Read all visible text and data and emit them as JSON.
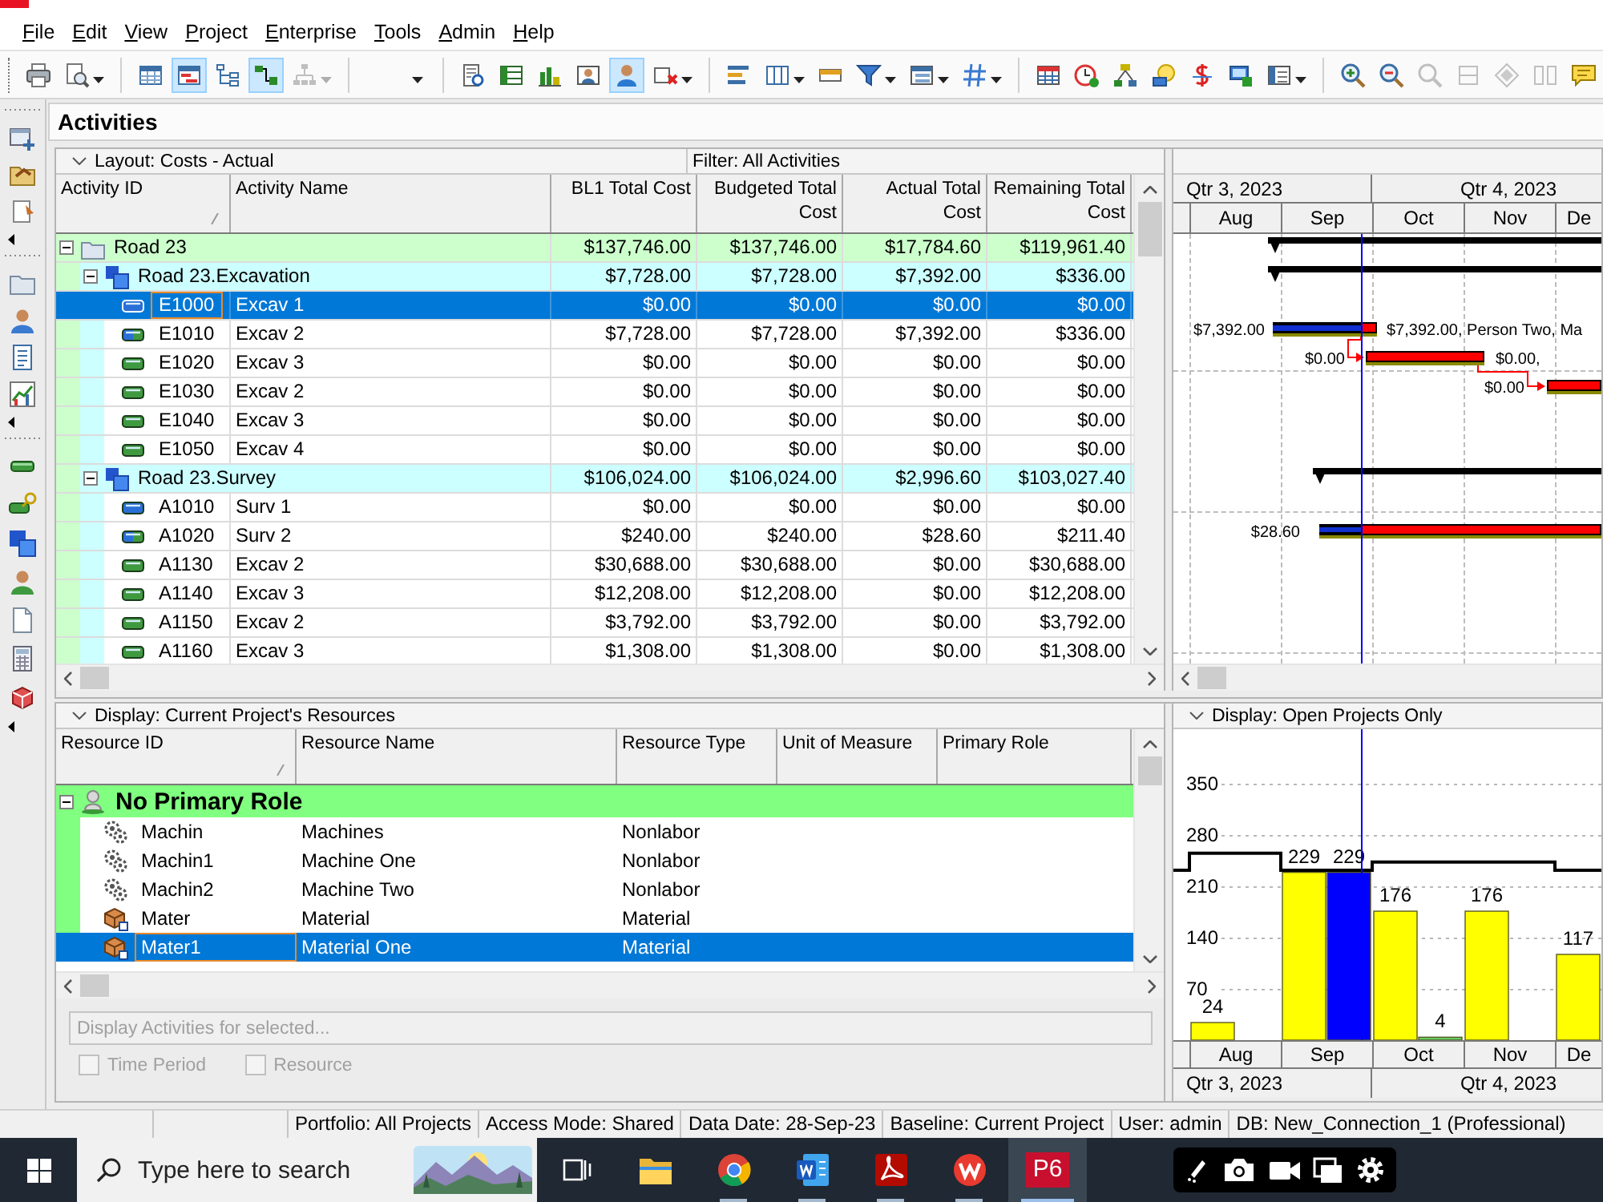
{
  "menu": [
    {
      "label": "File"
    },
    {
      "label": "Edit"
    },
    {
      "label": "View"
    },
    {
      "label": "Project"
    },
    {
      "label": "Enterprise"
    },
    {
      "label": "Tools"
    },
    {
      "label": "Admin"
    },
    {
      "label": "Help"
    }
  ],
  "toolbar": {
    "groups": [
      {
        "items": [
          {
            "kind": "printer",
            "pressed": false,
            "disabled": false
          },
          {
            "kind": "print_preview",
            "pressed": false,
            "disabled": false
          }
        ]
      },
      {
        "items": [
          {
            "kind": "table",
            "pressed": false,
            "disabled": false
          },
          {
            "kind": "gantt",
            "pressed": true,
            "disabled": false
          },
          {
            "kind": "tree",
            "pressed": false,
            "disabled": false
          },
          {
            "kind": "network",
            "pressed": true,
            "disabled": false
          },
          {
            "kind": "hierarchy",
            "pressed": false,
            "disabled": true
          }
        ]
      },
      {
        "items": [
          {
            "kind": "blank",
            "pressed": false,
            "disabled": false
          }
        ]
      },
      {
        "items": [
          {
            "kind": "report",
            "pressed": false,
            "disabled": false
          },
          {
            "kind": "spreadsheet",
            "pressed": false,
            "disabled": false
          },
          {
            "kind": "bar_chart",
            "pressed": false,
            "disabled": false
          },
          {
            "kind": "resource_table",
            "pressed": false,
            "disabled": false
          },
          {
            "kind": "person",
            "pressed": true,
            "disabled": false
          },
          {
            "kind": "cross",
            "pressed": false,
            "disabled": false
          }
        ]
      },
      {
        "items": [
          {
            "kind": "bars",
            "pressed": false,
            "disabled": false
          },
          {
            "kind": "columns",
            "pressed": false,
            "disabled": false
          },
          {
            "kind": "strip",
            "pressed": false,
            "disabled": false
          },
          {
            "kind": "filter",
            "pressed": false,
            "disabled": false
          },
          {
            "kind": "group",
            "pressed": false,
            "disabled": false
          },
          {
            "kind": "hash",
            "pressed": false,
            "disabled": false
          }
        ]
      },
      {
        "items": [
          {
            "kind": "grid",
            "pressed": false,
            "disabled": false
          },
          {
            "kind": "clock",
            "pressed": false,
            "disabled": false
          },
          {
            "kind": "network_diagram",
            "pressed": false,
            "disabled": false
          },
          {
            "kind": "bulb",
            "pressed": false,
            "disabled": false
          },
          {
            "kind": "dollar",
            "pressed": false,
            "disabled": false
          },
          {
            "kind": "monitor",
            "pressed": false,
            "disabled": false
          },
          {
            "kind": "list",
            "pressed": false,
            "disabled": false
          }
        ]
      },
      {
        "items": [
          {
            "kind": "zoom_in",
            "pressed": false,
            "disabled": false
          },
          {
            "kind": "zoom_out",
            "pressed": false,
            "disabled": false
          },
          {
            "kind": "zoom_fit",
            "pressed": false,
            "disabled": true
          },
          {
            "kind": "rows",
            "pressed": false,
            "disabled": true
          },
          {
            "kind": "diamond",
            "pressed": false,
            "disabled": true
          },
          {
            "kind": "split",
            "pressed": false,
            "disabled": true
          },
          {
            "kind": "comment",
            "pressed": false,
            "disabled": false
          }
        ]
      }
    ]
  },
  "page_title": "Activities",
  "activities": {
    "layout": "Layout: Costs - Actual",
    "filter": "Filter: All Activities",
    "columns": [
      {
        "label": "Activity ID",
        "sorted": true
      },
      {
        "label": "Activity Name",
        "sorted": false
      },
      {
        "label": "BL1 Total Cost",
        "sorted": false
      },
      {
        "label": "Budgeted Total Cost",
        "sorted": false
      },
      {
        "label": "Actual Total Cost",
        "sorted": false
      },
      {
        "label": "Remaining Total Cost",
        "sorted": false
      }
    ],
    "rows": [
      {
        "kind": "project",
        "label": "Road 23",
        "expanded": true,
        "selected": false,
        "costs": [
          "$137,746.00",
          "$137,746.00",
          "$17,784.60",
          "$119,961.40"
        ],
        "children": [
          {
            "kind": "wbs",
            "label": "Road 23.Excavation",
            "expanded": true,
            "selected": false,
            "costs": [
              "$7,728.00",
              "$7,728.00",
              "$7,392.00",
              "$336.00"
            ],
            "children": [
              {
                "kind": "completed",
                "id": "E1000",
                "name": "Excav 1",
                "selected": true,
                "costs": [
                  "$0.00",
                  "$0.00",
                  "$0.00",
                  "$0.00"
                ]
              },
              {
                "kind": "in_progress",
                "id": "E1010",
                "name": "Excav 2",
                "selected": false,
                "costs": [
                  "$7,728.00",
                  "$7,728.00",
                  "$7,392.00",
                  "$336.00"
                ],
                "bar_label_left": "$7,392.00",
                "bar_label_right": "$7,392.00, Person Two, Ma"
              },
              {
                "kind": "not_started",
                "id": "E1020",
                "name": "Excav 3",
                "selected": false,
                "costs": [
                  "$0.00",
                  "$0.00",
                  "$0.00",
                  "$0.00"
                ],
                "bar_label_left": "$0.00",
                "bar_label_right": "$0.00,"
              },
              {
                "kind": "not_started",
                "id": "E1030",
                "name": "Excav 2",
                "selected": false,
                "costs": [
                  "$0.00",
                  "$0.00",
                  "$0.00",
                  "$0.00"
                ],
                "bar_label_left": "$0.00"
              },
              {
                "kind": "not_started",
                "id": "E1040",
                "name": "Excav 3",
                "selected": false,
                "costs": [
                  "$0.00",
                  "$0.00",
                  "$0.00",
                  "$0.00"
                ]
              },
              {
                "kind": "not_started",
                "id": "E1050",
                "name": "Excav 4",
                "selected": false,
                "costs": [
                  "$0.00",
                  "$0.00",
                  "$0.00",
                  "$0.00"
                ]
              }
            ]
          },
          {
            "kind": "wbs",
            "label": "Road 23.Survey",
            "expanded": true,
            "selected": false,
            "costs": [
              "$106,024.00",
              "$106,024.00",
              "$2,996.60",
              "$103,027.40"
            ],
            "children": [
              {
                "kind": "completed",
                "id": "A1010",
                "name": "Surv 1",
                "selected": false,
                "costs": [
                  "$0.00",
                  "$0.00",
                  "$0.00",
                  "$0.00"
                ]
              },
              {
                "kind": "in_progress",
                "id": "A1020",
                "name": "Surv 2",
                "selected": false,
                "costs": [
                  "$240.00",
                  "$240.00",
                  "$28.60",
                  "$211.40"
                ],
                "bar_label_left": "$28.60"
              },
              {
                "kind": "not_started",
                "id": "A1130",
                "name": "Excav 2",
                "selected": false,
                "costs": [
                  "$30,688.00",
                  "$30,688.00",
                  "$0.00",
                  "$30,688.00"
                ]
              },
              {
                "kind": "not_started",
                "id": "A1140",
                "name": "Excav 3",
                "selected": false,
                "costs": [
                  "$12,208.00",
                  "$12,208.00",
                  "$0.00",
                  "$12,208.00"
                ]
              },
              {
                "kind": "not_started",
                "id": "A1150",
                "name": "Excav 2",
                "selected": false,
                "costs": [
                  "$3,792.00",
                  "$3,792.00",
                  "$0.00",
                  "$3,792.00"
                ]
              },
              {
                "kind": "not_started",
                "id": "A1160",
                "name": "Excav 3",
                "selected": false,
                "costs": [
                  "$1,308.00",
                  "$1,308.00",
                  "$0.00",
                  "$1,308.00"
                ]
              }
            ]
          }
        ]
      }
    ]
  },
  "gantt": {
    "quarters": [
      "Qtr 3, 2023",
      "Qtr 4, 2023"
    ],
    "months": [
      "Aug",
      "Sep",
      "Oct",
      "Nov",
      "De"
    ]
  },
  "resources": {
    "display": "Display: Current Project's Resources",
    "columns": [
      {
        "label": "Resource ID",
        "sorted": true
      },
      {
        "label": "Resource Name",
        "sorted": false
      },
      {
        "label": "Resource Type",
        "sorted": false
      },
      {
        "label": "Unit of Measure",
        "sorted": false
      },
      {
        "label": "Primary Role",
        "sorted": false
      }
    ],
    "groups": [
      {
        "kind": "role",
        "label": "No Primary Role",
        "expanded": true,
        "selected": false,
        "children": [
          {
            "kind": "nonlabor",
            "id": "Machin",
            "name": "Machines",
            "type": "Nonlabor",
            "selected": false
          },
          {
            "kind": "nonlabor",
            "id": "Machin1",
            "name": "Machine One",
            "type": "Nonlabor",
            "selected": false
          },
          {
            "kind": "nonlabor",
            "id": "Machin2",
            "name": "Machine Two",
            "type": "Nonlabor",
            "selected": false
          },
          {
            "kind": "material",
            "id": "Mater",
            "name": "Material",
            "type": "Material",
            "selected": false
          },
          {
            "kind": "material",
            "id": "Mater1",
            "name": "Material One",
            "type": "Material",
            "selected": true
          }
        ]
      }
    ],
    "display_activities": {
      "label": "Display Activities for selected...",
      "disabled": true
    },
    "options": [
      {
        "label": "Time Period",
        "checked": false,
        "disabled": true
      },
      {
        "label": "Resource",
        "checked": false,
        "disabled": true
      }
    ]
  },
  "histogram": {
    "display": "Display: Open Projects Only",
    "chart_data": {
      "type": "bar",
      "categories": [
        "Aug",
        "Sep",
        "Oct",
        "Nov",
        "De"
      ],
      "series": [
        {
          "color": "#ffff00",
          "values": [
            24,
            229,
            176,
            176,
            117
          ]
        },
        {
          "color": "#0000ff",
          "values": [
            null,
            229,
            null,
            null,
            null
          ]
        },
        {
          "color": "#66cc66",
          "values": [
            null,
            null,
            4,
            null,
            null
          ]
        }
      ],
      "ylim": [
        0,
        420
      ],
      "yticks": [
        70,
        140,
        210,
        280,
        350
      ],
      "grid": true,
      "data_labels": true
    },
    "quarters": [
      "Qtr 3, 2023",
      "Qtr 4, 2023"
    ]
  },
  "status_bar": [
    "Portfolio: All Projects",
    "Access Mode: Shared",
    "Data Date: 28-Sep-23",
    "Baseline: Current Project",
    "User: admin",
    "DB: New_Connection_1 (Professional)"
  ],
  "taskbar": {
    "search": {
      "placeholder": "Type here to search"
    },
    "apps": [
      {
        "kind": "task_view",
        "open": false,
        "selected": false
      },
      {
        "kind": "folder",
        "open": false,
        "selected": false
      },
      {
        "kind": "ring",
        "open": true,
        "selected": false
      },
      {
        "kind": "word",
        "open": true,
        "selected": false
      },
      {
        "kind": "pdf",
        "open": true,
        "selected": false
      },
      {
        "kind": "wps",
        "open": true,
        "selected": false
      },
      {
        "kind": "p6",
        "label": "P6",
        "open": true,
        "selected": true
      }
    ]
  }
}
